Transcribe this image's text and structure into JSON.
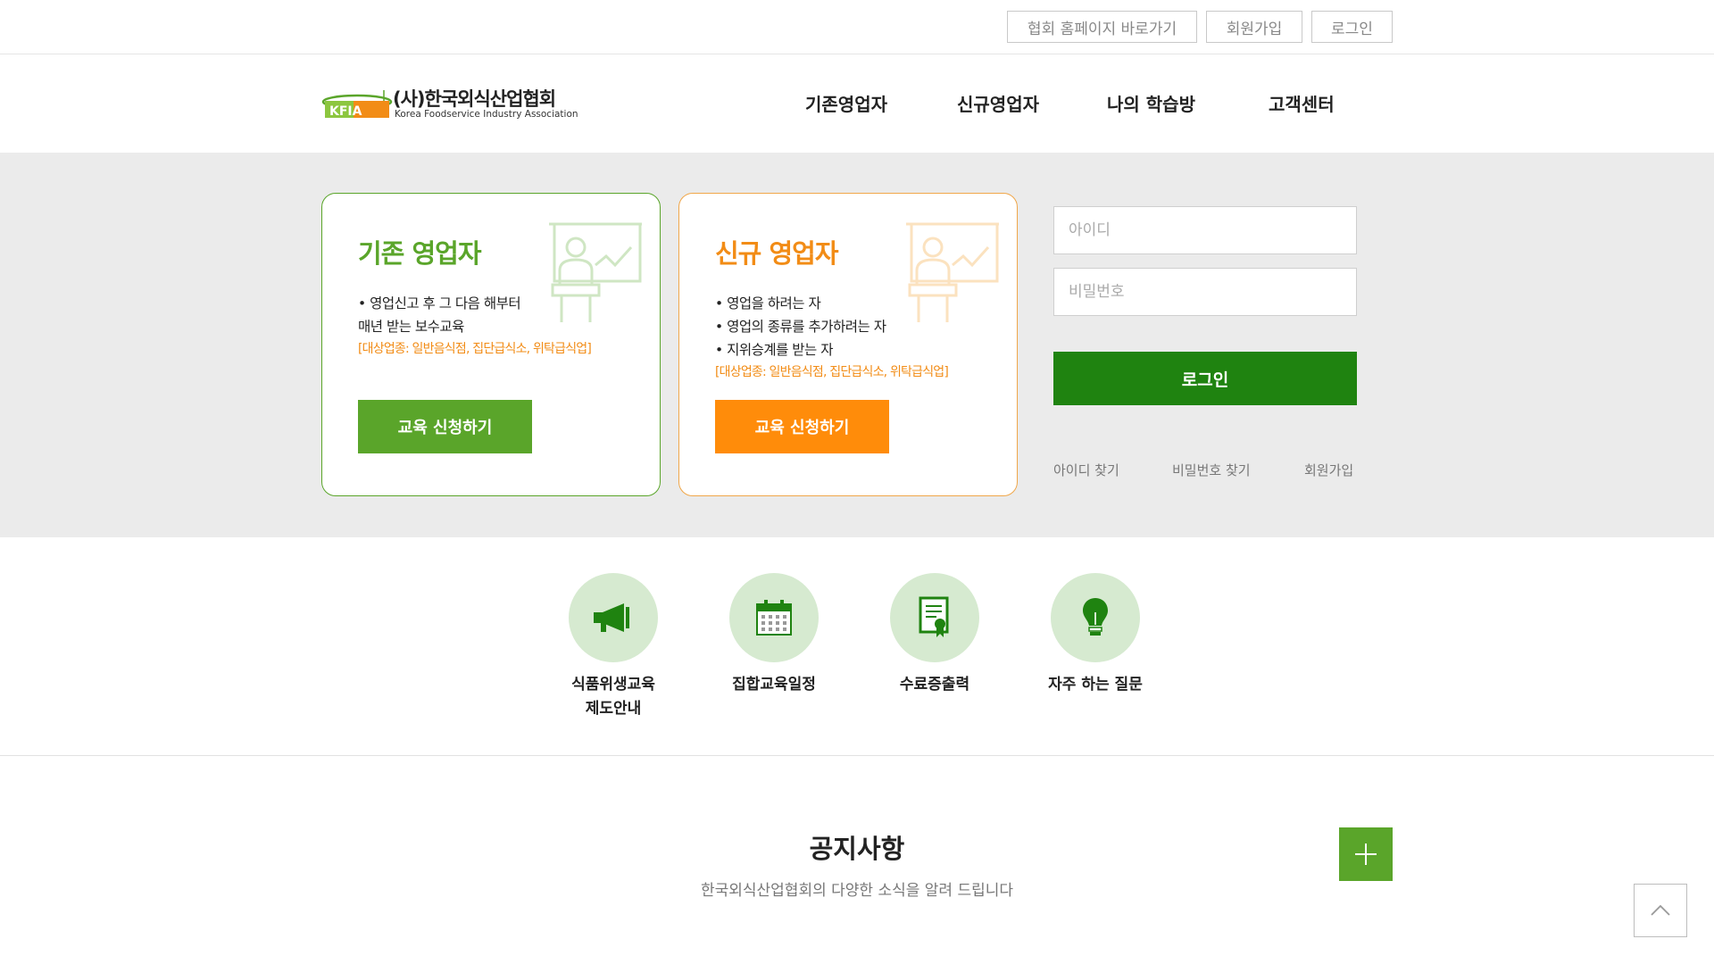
{
  "topbar": {
    "links": [
      "협회 홈페이지 바로가기",
      "회원가입",
      "로그인"
    ]
  },
  "header": {
    "logo_text": "(사)한국외식산업협회",
    "logo_sub": "Korea Foodservice Industry Association",
    "logo_mark": "KFIA",
    "nav": [
      "기존영업자",
      "신규영업자",
      "나의 학습방",
      "고객센터"
    ]
  },
  "cards": {
    "existing": {
      "title": "기존 영업자",
      "desc": [
        "• 영업신고 후 그 다음 해부터",
        "매년 받는 보수교육"
      ],
      "target": "[대상업종: 일반음식점, 집단급식소, 위탁급식업]",
      "button": "교육 신청하기",
      "icon": "teacher-board-icon",
      "color": "#5aa52a"
    },
    "new": {
      "title": "신규 영업자",
      "desc": [
        "• 영업을 하려는 자",
        "• 영업의 종류를 추가하려는 자",
        "• 지위승계를 받는 자"
      ],
      "target": "[대상업종: 일반음식점, 집단급식소, 위탁급식업]",
      "button": "교육 신청하기",
      "icon": "teacher-board-icon",
      "color": "#ff8c0a"
    }
  },
  "login": {
    "id_placeholder": "아이디",
    "pw_placeholder": "비밀번호",
    "button": "로그인",
    "links": [
      "아이디 찾기",
      "비밀번호 찾기",
      "회원가입"
    ],
    "button_color": "#1f8310"
  },
  "quick_menu": [
    {
      "label": "식품위생교육\n제도안내",
      "icon": "megaphone-icon"
    },
    {
      "label": "집합교육일정",
      "icon": "calendar-icon"
    },
    {
      "label": "수료증출력",
      "icon": "certificate-icon"
    },
    {
      "label": "자주 하는 질문",
      "icon": "lightbulb-icon"
    }
  ],
  "notice": {
    "title": "공지사항",
    "subtitle": "한국외식산업협회의 다양한 소식을 알려 드립니다",
    "more_icon": "plus-icon"
  },
  "scroll_top_icon": "chevron-up-icon"
}
